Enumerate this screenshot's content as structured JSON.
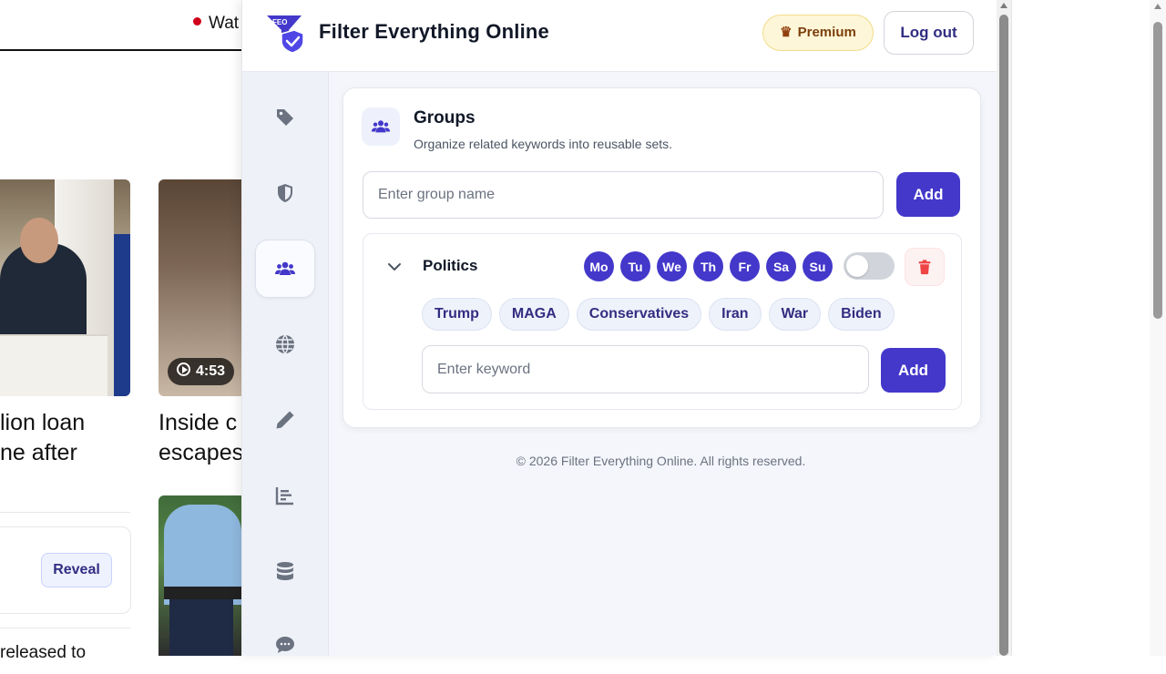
{
  "background_page": {
    "live_label": "Wat",
    "video_duration": "4:53",
    "headline_1": "lion loan\nne after",
    "headline_2": "Inside c\nescapes",
    "reveal_label": "Reveal",
    "released_text": "released to"
  },
  "header": {
    "logo_text": "FEO",
    "title": "Filter Everything Online",
    "premium_label": "Premium",
    "logout_label": "Log out"
  },
  "sidebar": {
    "items": [
      {
        "name": "keywords",
        "icon": "tag-icon"
      },
      {
        "name": "blocking",
        "icon": "shield-icon"
      },
      {
        "name": "groups",
        "icon": "users-icon",
        "active": true
      },
      {
        "name": "sites",
        "icon": "globe-icon"
      },
      {
        "name": "customize",
        "icon": "pencil-icon"
      },
      {
        "name": "stats",
        "icon": "chart-icon"
      },
      {
        "name": "data",
        "icon": "database-icon"
      },
      {
        "name": "feedback",
        "icon": "chat-icon"
      }
    ]
  },
  "groups": {
    "title": "Groups",
    "subtitle": "Organize related keywords into reusable sets.",
    "input_placeholder": "Enter group name",
    "input_value": "",
    "add_label": "Add",
    "list": [
      {
        "name": "Politics",
        "days": [
          "Mo",
          "Tu",
          "We",
          "Th",
          "Fr",
          "Sa",
          "Su"
        ],
        "enabled": false,
        "keywords": [
          "Trump",
          "MAGA",
          "Conservatives",
          "Iran",
          "War",
          "Biden"
        ],
        "keyword_placeholder": "Enter keyword",
        "keyword_add_label": "Add"
      }
    ]
  },
  "footer": {
    "text": "© 2026 Filter Everything Online. All rights reserved."
  },
  "colors": {
    "accent": "#4338ca",
    "premium_bg": "#fdf6d8",
    "danger": "#ef4444",
    "panel_bg": "#f4f6fb"
  }
}
